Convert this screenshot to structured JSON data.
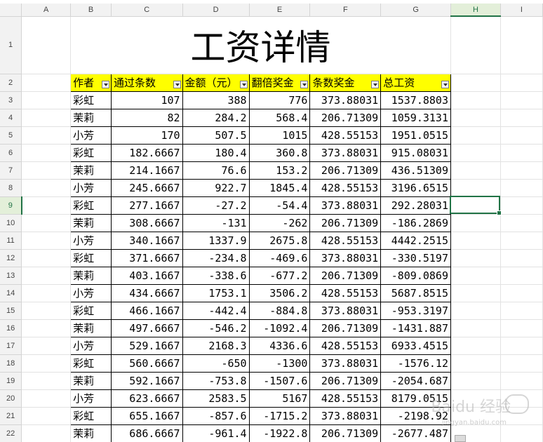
{
  "column_headers": [
    "A",
    "B",
    "C",
    "D",
    "E",
    "F",
    "G",
    "H",
    "I"
  ],
  "selected_column": "H",
  "selected_row": 9,
  "title": "工资详情",
  "table_headers": [
    "作者",
    "通过条数",
    "金额（元）",
    "翻倍奖金",
    "条数奖金",
    "总工资"
  ],
  "rows": [
    {
      "n": 3,
      "cells": [
        "彩虹",
        "107",
        "388",
        "776",
        "373.88031",
        "1537.8803"
      ]
    },
    {
      "n": 4,
      "cells": [
        "茉莉",
        "82",
        "284.2",
        "568.4",
        "206.71309",
        "1059.3131"
      ]
    },
    {
      "n": 5,
      "cells": [
        "小芳",
        "170",
        "507.5",
        "1015",
        "428.55153",
        "1951.0515"
      ]
    },
    {
      "n": 6,
      "cells": [
        "彩虹",
        "182.6667",
        "180.4",
        "360.8",
        "373.88031",
        "915.08031"
      ]
    },
    {
      "n": 7,
      "cells": [
        "茉莉",
        "214.1667",
        "76.6",
        "153.2",
        "206.71309",
        "436.51309"
      ]
    },
    {
      "n": 8,
      "cells": [
        "小芳",
        "245.6667",
        "922.7",
        "1845.4",
        "428.55153",
        "3196.6515"
      ]
    },
    {
      "n": 9,
      "cells": [
        "彩虹",
        "277.1667",
        "-27.2",
        "-54.4",
        "373.88031",
        "292.28031"
      ]
    },
    {
      "n": 10,
      "cells": [
        "茉莉",
        "308.6667",
        "-131",
        "-262",
        "206.71309",
        "-186.2869"
      ]
    },
    {
      "n": 11,
      "cells": [
        "小芳",
        "340.1667",
        "1337.9",
        "2675.8",
        "428.55153",
        "4442.2515"
      ]
    },
    {
      "n": 12,
      "cells": [
        "彩虹",
        "371.6667",
        "-234.8",
        "-469.6",
        "373.88031",
        "-330.5197"
      ]
    },
    {
      "n": 13,
      "cells": [
        "茉莉",
        "403.1667",
        "-338.6",
        "-677.2",
        "206.71309",
        "-809.0869"
      ]
    },
    {
      "n": 14,
      "cells": [
        "小芳",
        "434.6667",
        "1753.1",
        "3506.2",
        "428.55153",
        "5687.8515"
      ]
    },
    {
      "n": 15,
      "cells": [
        "彩虹",
        "466.1667",
        "-442.4",
        "-884.8",
        "373.88031",
        "-953.3197"
      ]
    },
    {
      "n": 16,
      "cells": [
        "茉莉",
        "497.6667",
        "-546.2",
        "-1092.4",
        "206.71309",
        "-1431.887"
      ]
    },
    {
      "n": 17,
      "cells": [
        "小芳",
        "529.1667",
        "2168.3",
        "4336.6",
        "428.55153",
        "6933.4515"
      ]
    },
    {
      "n": 18,
      "cells": [
        "彩虹",
        "560.6667",
        "-650",
        "-1300",
        "373.88031",
        "-1576.12"
      ]
    },
    {
      "n": 19,
      "cells": [
        "茉莉",
        "592.1667",
        "-753.8",
        "-1507.6",
        "206.71309",
        "-2054.687"
      ]
    },
    {
      "n": 20,
      "cells": [
        "小芳",
        "623.6667",
        "2583.5",
        "5167",
        "428.55153",
        "8179.0515"
      ]
    },
    {
      "n": 21,
      "cells": [
        "彩虹",
        "655.1667",
        "-857.6",
        "-1715.2",
        "373.88031",
        "-2198.92"
      ]
    },
    {
      "n": 22,
      "cells": [
        "茉莉",
        "686.6667",
        "-961.4",
        "-1922.8",
        "206.71309",
        "-2677.487"
      ]
    }
  ],
  "watermark": {
    "text": "Baidu 经验",
    "url": "jingyan.baidu.com"
  },
  "colors": {
    "header_fill": "#ffff00",
    "selection": "#217346"
  }
}
